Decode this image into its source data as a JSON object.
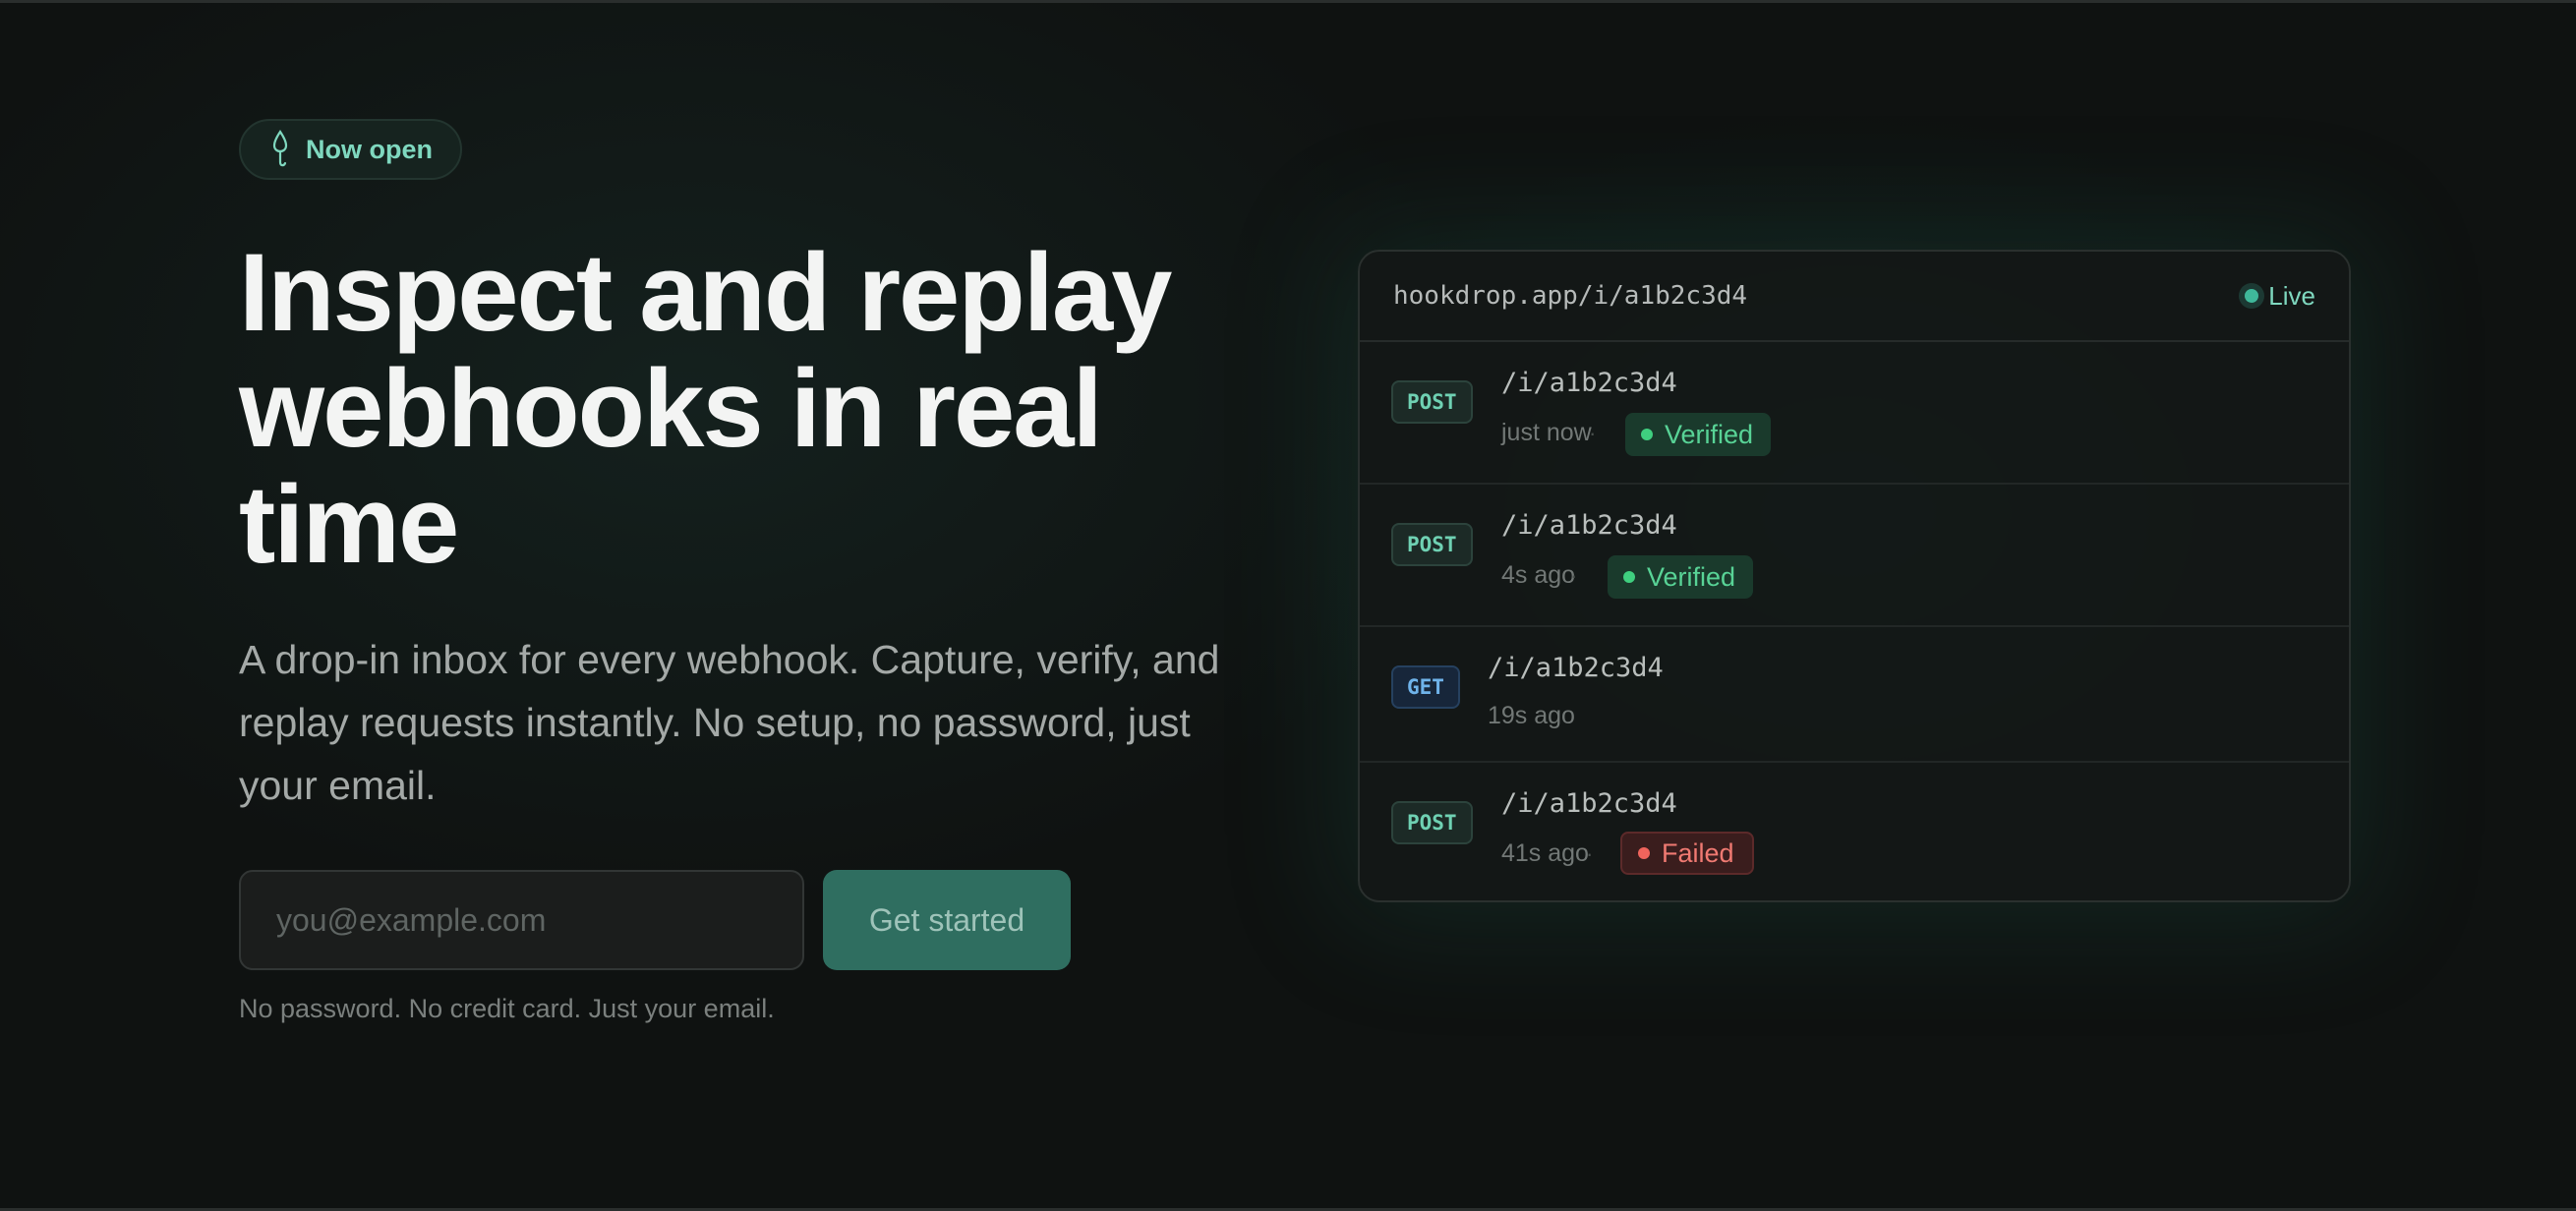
{
  "hero": {
    "badge_label": "Now open",
    "badge_icon": "hook-icon",
    "headline": "Inspect and replay webhooks in real time",
    "subtext": "A drop-in inbox for every webhook. Capture, verify, and replay requests instantly. No setup, no password, just your email.",
    "email_placeholder": "you@example.com",
    "cta_label": "Get started",
    "fineprint": "No password. No credit card. Just your email."
  },
  "inbox": {
    "url": "hookdrop.app/i/a1b2c3d4",
    "live_label": "Live",
    "separator": "·",
    "requests": [
      {
        "method": "POST",
        "path": "/i/a1b2c3d4",
        "time": "just now",
        "status": "Verified"
      },
      {
        "method": "POST",
        "path": "/i/a1b2c3d4",
        "time": "4s ago",
        "status": "Verified"
      },
      {
        "method": "GET",
        "path": "/i/a1b2c3d4",
        "time": "19s ago",
        "status": ""
      },
      {
        "method": "POST",
        "path": "/i/a1b2c3d4",
        "time": "41s ago",
        "status": "Failed"
      }
    ]
  },
  "colors": {
    "accent": "#7fd8bf",
    "background": "#0f1211",
    "cta": "#2f6e60",
    "verified": "#58d396",
    "failed": "#f07a72",
    "get_method": "#6fb3ea"
  }
}
